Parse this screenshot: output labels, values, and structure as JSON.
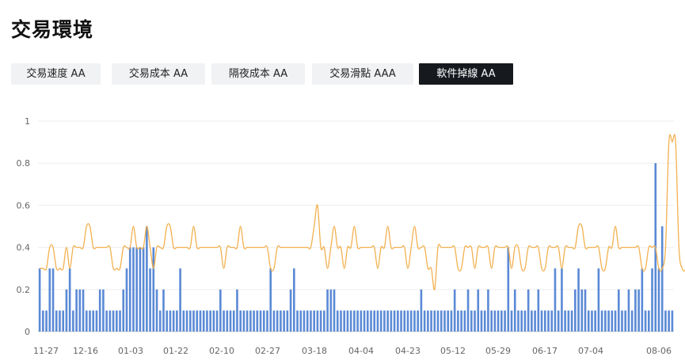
{
  "page": {
    "title": "交易環境"
  },
  "tabs": [
    {
      "label": "交易速度 AA",
      "active": false
    },
    {
      "label": "交易成本 AA",
      "active": false
    },
    {
      "label": "隔夜成本 AA",
      "active": false
    },
    {
      "label": "交易滑點 AAA",
      "active": false
    },
    {
      "label": "軟件掉線 AA",
      "active": true
    }
  ],
  "colors": {
    "bar": "#5b8ad6",
    "line": "#f2b04e",
    "active_tab": "#161a1f",
    "tab": "#f1f2f4"
  },
  "chart_data": {
    "type": "bar",
    "ylim": [
      0,
      1
    ],
    "yticks": [
      "0",
      "0.2",
      "0.4",
      "0.6",
      "0.8",
      "1"
    ],
    "xticks": [
      "11-27",
      "12-16",
      "01-03",
      "01-22",
      "02-10",
      "02-27",
      "03-18",
      "04-04",
      "04-23",
      "05-12",
      "05-29",
      "06-17",
      "07-04",
      "08-06"
    ],
    "grid": true,
    "series": [
      {
        "type": "bar",
        "values": [
          0.3,
          0.1,
          0.1,
          0.3,
          0.3,
          0.1,
          0.1,
          0.1,
          0.2,
          0.3,
          0.1,
          0.2,
          0.2,
          0.2,
          0.1,
          0.1,
          0.1,
          0.1,
          0.2,
          0.2,
          0.1,
          0.1,
          0.1,
          0.1,
          0.1,
          0.2,
          0.3,
          0.4,
          0.4,
          0.4,
          0.4,
          0.4,
          0.5,
          0.3,
          0.4,
          0.2,
          0.1,
          0.2,
          0.1,
          0.1,
          0.1,
          0.1,
          0.3,
          0.1,
          0.1,
          0.1,
          0.1,
          0.1,
          0.1,
          0.1,
          0.1,
          0.1,
          0.1,
          0.1,
          0.2,
          0.1,
          0.1,
          0.1,
          0.1,
          0.2,
          0.1,
          0.1,
          0.1,
          0.1,
          0.1,
          0.1,
          0.1,
          0.1,
          0.1,
          0.3,
          0.1,
          0.1,
          0.1,
          0.1,
          0.1,
          0.2,
          0.3,
          0.1,
          0.1,
          0.1,
          0.1,
          0.1,
          0.1,
          0.1,
          0.1,
          0.1,
          0.2,
          0.2,
          0.2,
          0.1,
          0.1,
          0.1,
          0.1,
          0.1,
          0.1,
          0.1,
          0.1,
          0.1,
          0.1,
          0.1,
          0.1,
          0.1,
          0.1,
          0.1,
          0.1,
          0.1,
          0.1,
          0.1,
          0.1,
          0.1,
          0.1,
          0.1,
          0.1,
          0.1,
          0.2,
          0.1,
          0.1,
          0.1,
          0.1,
          0.1,
          0.1,
          0.1,
          0.1,
          0.1,
          0.2,
          0.1,
          0.1,
          0.1,
          0.2,
          0.1,
          0.1,
          0.2,
          0.1,
          0.1,
          0.2,
          0.1,
          0.1,
          0.1,
          0.1,
          0.1,
          0.4,
          0.1,
          0.2,
          0.1,
          0.1,
          0.1,
          0.2,
          0.1,
          0.1,
          0.2,
          0.1,
          0.1,
          0.1,
          0.1,
          0.3,
          0.1,
          0.3,
          0.1,
          0.1,
          0.1,
          0.2,
          0.3,
          0.2,
          0.2,
          0.1,
          0.1,
          0.1,
          0.3,
          0.1,
          0.1,
          0.1,
          0.1,
          0.1,
          0.2,
          0.1,
          0.1,
          0.2,
          0.1,
          0.2,
          0.2,
          0.3,
          0.1,
          0.1,
          0.3,
          0.8,
          0.3,
          0.5,
          0.1,
          0.1,
          0.1
        ]
      },
      {
        "type": "line",
        "values": [
          0.3,
          0.3,
          0.3,
          0.4,
          0.4,
          0.3,
          0.3,
          0.3,
          0.4,
          0.3,
          0.4,
          0.4,
          0.4,
          0.4,
          0.5,
          0.5,
          0.4,
          0.4,
          0.4,
          0.4,
          0.4,
          0.4,
          0.3,
          0.3,
          0.3,
          0.4,
          0.4,
          0.4,
          0.5,
          0.4,
          0.4,
          0.4,
          0.5,
          0.4,
          0.3,
          0.4,
          0.4,
          0.4,
          0.5,
          0.5,
          0.4,
          0.4,
          0.4,
          0.4,
          0.4,
          0.4,
          0.5,
          0.4,
          0.4,
          0.4,
          0.4,
          0.4,
          0.4,
          0.4,
          0.4,
          0.3,
          0.4,
          0.4,
          0.4,
          0.4,
          0.5,
          0.4,
          0.4,
          0.4,
          0.4,
          0.4,
          0.4,
          0.4,
          0.4,
          0.3,
          0.3,
          0.4,
          0.4,
          0.4,
          0.4,
          0.4,
          0.4,
          0.4,
          0.4,
          0.4,
          0.4,
          0.4,
          0.5,
          0.6,
          0.4,
          0.4,
          0.3,
          0.4,
          0.5,
          0.4,
          0.4,
          0.3,
          0.4,
          0.4,
          0.5,
          0.4,
          0.4,
          0.4,
          0.4,
          0.4,
          0.4,
          0.3,
          0.4,
          0.4,
          0.5,
          0.4,
          0.4,
          0.4,
          0.4,
          0.4,
          0.3,
          0.4,
          0.5,
          0.4,
          0.4,
          0.4,
          0.3,
          0.3,
          0.2,
          0.4,
          0.4,
          0.4,
          0.4,
          0.4,
          0.4,
          0.3,
          0.3,
          0.4,
          0.4,
          0.4,
          0.3,
          0.4,
          0.4,
          0.4,
          0.4,
          0.3,
          0.4,
          0.4,
          0.4,
          0.4,
          0.4,
          0.3,
          0.4,
          0.4,
          0.3,
          0.3,
          0.4,
          0.4,
          0.4,
          0.4,
          0.3,
          0.3,
          0.4,
          0.4,
          0.4,
          0.4,
          0.3,
          0.4,
          0.4,
          0.4,
          0.4,
          0.5,
          0.5,
          0.4,
          0.4,
          0.4,
          0.4,
          0.4,
          0.3,
          0.3,
          0.4,
          0.4,
          0.5,
          0.4,
          0.4,
          0.4,
          0.4,
          0.4,
          0.4,
          0.4,
          0.3,
          0.3,
          0.4,
          0.4,
          0.4,
          0.3,
          0.3,
          0.4,
          0.9,
          0.9,
          0.9,
          0.4,
          0.3,
          0.3,
          0.4
        ]
      }
    ]
  }
}
